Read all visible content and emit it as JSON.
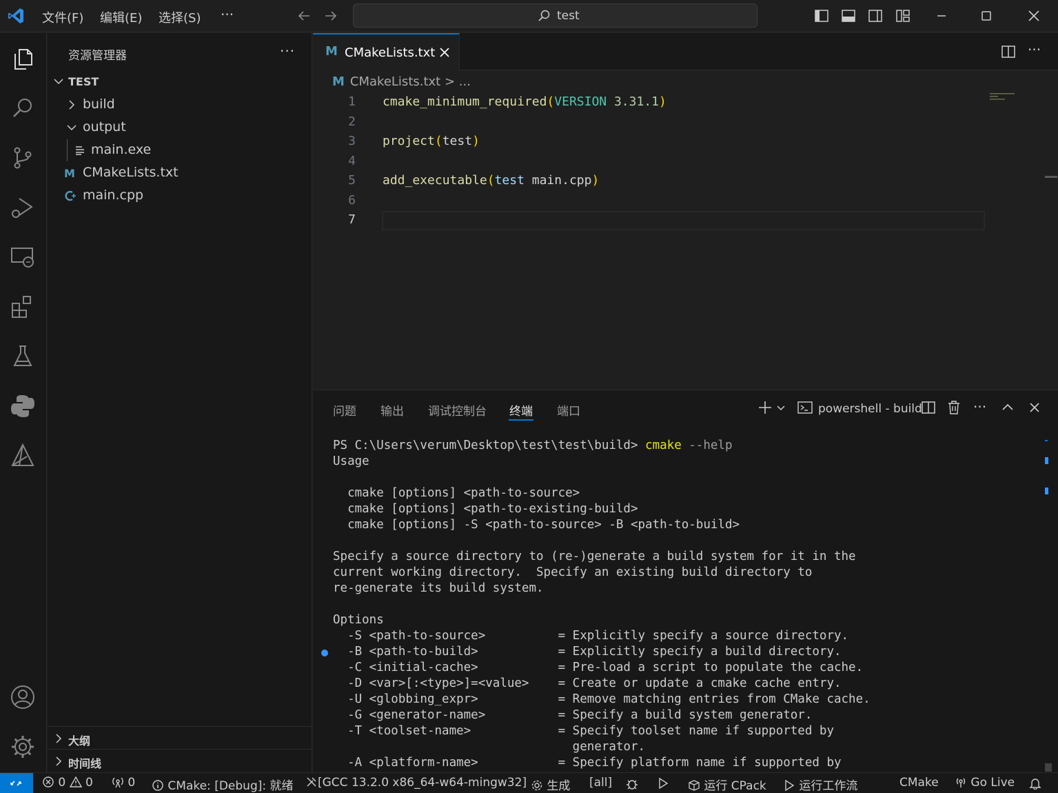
{
  "menu": {
    "file": "文件(F)",
    "edit": "编辑(E)",
    "selection": "选择(S)",
    "more": "···"
  },
  "search": {
    "text": "test"
  },
  "sidebar": {
    "title": "资源管理器",
    "more": "···",
    "root": "TEST",
    "items": [
      {
        "label": "build",
        "icon": "chevron-right-icon"
      },
      {
        "label": "output",
        "icon": "chevron-down-icon"
      },
      {
        "label": "main.exe",
        "icon": "file-lines-icon"
      },
      {
        "label": "CMakeLists.txt",
        "icon": "cmake-m-icon"
      },
      {
        "label": "main.cpp",
        "icon": "cpp-icon"
      }
    ],
    "outline": "大纲",
    "timeline": "时间线"
  },
  "editor": {
    "tab_label": "CMakeLists.txt",
    "tab_icon_letter": "M",
    "breadcrumb_file": "CMakeLists.txt",
    "breadcrumb_rest": " > ...",
    "line_numbers": [
      "1",
      "2",
      "3",
      "4",
      "5",
      "6",
      "7"
    ],
    "code": {
      "l1_fn": "cmake_minimum_required",
      "l1_open": "(",
      "l1_kw": "VERSION",
      "l1_num": " 3.31.1",
      "l1_close": ")",
      "l3_fn": "project",
      "l3_open": "(",
      "l3_arg": "test",
      "l3_close": ")",
      "l5_fn": "add_executable",
      "l5_open": "(",
      "l5_arg1": "test",
      "l5_arg2": " main.cpp",
      "l5_close": ")"
    }
  },
  "panel": {
    "tabs": [
      "问题",
      "输出",
      "调试控制台",
      "终端",
      "端口"
    ],
    "active_tab": "终端",
    "terminal_name": "powershell - build",
    "more": "···"
  },
  "terminal": {
    "prompt": "PS C:\\Users\\verum\\Desktop\\test\\test\\build> ",
    "command": "cmake",
    "args": " --help",
    "lines": [
      "Usage",
      "",
      "  cmake [options] <path-to-source>",
      "  cmake [options] <path-to-existing-build>",
      "  cmake [options] -S <path-to-source> -B <path-to-build>",
      "",
      "Specify a source directory to (re-)generate a build system for it in the",
      "current working directory.  Specify an existing build directory to",
      "re-generate its build system.",
      "",
      "Options",
      "  -S <path-to-source>          = Explicitly specify a source directory.",
      "  -B <path-to-build>           = Explicitly specify a build directory.",
      "  -C <initial-cache>           = Pre-load a script to populate the cache.",
      "  -D <var>[:<type>]=<value>    = Create or update a cmake cache entry.",
      "  -U <globbing_expr>           = Remove matching entries from CMake cache.",
      "  -G <generator-name>          = Specify a build system generator.",
      "  -T <toolset-name>            = Specify toolset name if supported by",
      "                                 generator.",
      "  -A <platform-name>           = Specify platform name if supported by"
    ]
  },
  "statusbar": {
    "errors": "0",
    "warnings": "0",
    "ports": "0",
    "cmake_status": "CMake: [Debug]: 就绪",
    "kit": "[GCC 13.2.0 x86_64-w64-mingw32]",
    "build": "生成",
    "target": "[all]",
    "cpack": "运行 CPack",
    "workflow": "运行工作流",
    "cmake": "CMake",
    "golive": "Go Live"
  },
  "colors": {
    "accent": "#0078d4",
    "cmake_icon": "#519aba",
    "cpp_icon": "#519aba"
  }
}
